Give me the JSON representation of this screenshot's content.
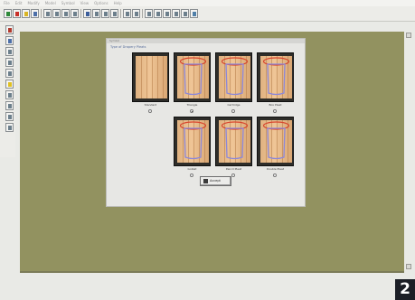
{
  "menubar": {
    "items": [
      "File",
      "Edit",
      "Modify",
      "Model",
      "Symbol",
      "View",
      "Options",
      "Help"
    ]
  },
  "toolbar": {
    "buttons": [
      {
        "icon": "new-icon"
      },
      {
        "icon": "paint-icon"
      },
      {
        "icon": "open-icon"
      },
      {
        "icon": "save-icon"
      },
      {
        "icon": "cut-icon"
      },
      {
        "icon": "undo-icon"
      },
      {
        "icon": "redo-icon"
      },
      {
        "icon": "text-icon"
      },
      {
        "icon": "pointer-icon"
      },
      {
        "icon": "measure-icon"
      },
      {
        "icon": "grid-icon"
      },
      {
        "icon": "zoom-icon"
      },
      {
        "icon": "print-icon"
      },
      {
        "icon": "curve-icon"
      },
      {
        "icon": "line-icon"
      },
      {
        "icon": "shape-icon"
      },
      {
        "icon": "layer-icon"
      },
      {
        "icon": "mirror-icon"
      },
      {
        "icon": "rotate-icon"
      },
      {
        "icon": "help-icon"
      }
    ]
  },
  "palette": {
    "tools": [
      {
        "icon": "select-tool-icon"
      },
      {
        "icon": "move-tool-icon"
      },
      {
        "icon": "draw-tool-icon"
      },
      {
        "icon": "curve-tool-icon"
      },
      {
        "icon": "cut-tool-icon"
      },
      {
        "icon": "point-tool-icon"
      },
      {
        "icon": "seam-tool-icon"
      },
      {
        "icon": "measure-tool-icon"
      },
      {
        "icon": "notch-tool-icon"
      },
      {
        "icon": "text-tool-icon"
      }
    ]
  },
  "dialog": {
    "title": "Symbol",
    "heading": "Type of Drapery Pleats",
    "tiles": [
      {
        "caption": "Standard",
        "style": "plain",
        "selected": false
      },
      {
        "caption": "Triangle",
        "style": "pinch",
        "selected": true
      },
      {
        "caption": "Cartridge",
        "style": "pinch",
        "selected": false
      },
      {
        "caption": "Box Pleat",
        "style": "pinch",
        "selected": false
      },
      {
        "caption": "Goblet",
        "style": "pinch",
        "selected": false
      },
      {
        "caption": "Pencil Pleat",
        "style": "pinch",
        "selected": false
      },
      {
        "caption": "Double Pleat",
        "style": "pinch",
        "selected": false
      }
    ],
    "ok_label": "Accept"
  },
  "page_badge": "2",
  "colors": {
    "workspace": "#929260",
    "dialog": "#e7e7e4",
    "fabric": "#e9b989",
    "pleat_outline": "#8c87d9",
    "header_outline": "#d8452e"
  }
}
